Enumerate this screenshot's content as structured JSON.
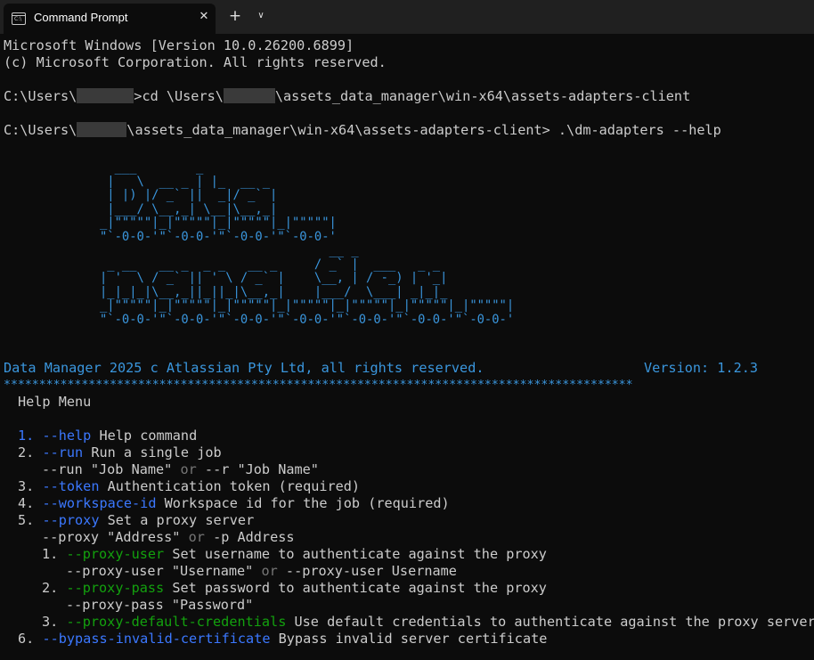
{
  "window": {
    "tab_title": "Command Prompt",
    "tab_icon": "cmd-icon",
    "close_glyph": "✕",
    "new_tab_glyph": "+",
    "dropdown_glyph": "∨"
  },
  "console": {
    "banner": [
      "Microsoft Windows [Version 10.0.26200.6899]",
      "(c) Microsoft Corporation. All rights reserved."
    ],
    "cmd1": {
      "prefix": "C:\\Users\\",
      "mid": ">cd \\Users\\",
      "suffix": "\\assets_data_manager\\win-x64\\assets-adapters-client"
    },
    "cmd2": {
      "prefix": "C:\\Users\\",
      "suffix": "\\assets_data_manager\\win-x64\\assets-adapters-client> .\\dm-adapters --help"
    },
    "ascii_art": [
      "  ___        _         ",
      " |   \\  __ _ | |_  __ _ ",
      " | |) |/ _` ||  _|/ _` |",
      " |___/ \\__,_| \\__|\\__,_|",
      "_|\"\"\"\"\"|_|\"\"\"\"\"|_|\"\"\"\"\"|_|\"\"\"\"\"|",
      "\"`-0-0-'\"`-0-0-'\"`-0-0-'\"`-0-0-'",
      "                               __ _               ",
      " _ __   __ _  _ _   __ _     / _` |  ___   _ _  ",
      "| '  \\ / _` || ' \\ / _` |    \\__, | / -_) | '_| ",
      "|_|_|_|\\__,_||_||_|\\__,_|    |___/  \\___| _|_|_ ",
      "_|\"\"\"\"\"|_|\"\"\"\"\"|_|\"\"\"\"\"|_|\"\"\"\"\"|_|\"\"\"\"\"|_|\"\"\"\"\"|_|\"\"\"\"\"|",
      "\"`-0-0-'\"`-0-0-'\"`-0-0-'\"`-0-0-'\"`-0-0-'\"`-0-0-'\"`-0-0-'"
    ],
    "copyright": "Data Manager 2025 c Atlassian Pty Ltd, all rights reserved.",
    "version": "Version: 1.2.3",
    "separator": "*****************************************************************************************",
    "help_title": "Help Menu",
    "items": {
      "i1": {
        "num": "1.",
        "flag": "--help",
        "desc": "Help command"
      },
      "i2": {
        "num": "2.",
        "flag": "--run",
        "desc": "Run a single job"
      },
      "i2u": {
        "a": "--run \"Job Name\"",
        "or": "or",
        "b": "--r \"Job Name\""
      },
      "i3": {
        "num": "3.",
        "flag": "--token",
        "desc": "Authentication token (required)"
      },
      "i4": {
        "num": "4.",
        "flag": "--workspace-id",
        "desc": "Workspace id for the job (required)"
      },
      "i5": {
        "num": "5.",
        "flag": "--proxy",
        "desc": "Set a proxy server"
      },
      "i5u": {
        "a": "--proxy \"Address\"",
        "or": "or",
        "b": "-p Address"
      },
      "s1": {
        "num": "1.",
        "flag": "--proxy-user",
        "desc": "Set username to authenticate against the proxy"
      },
      "s1u": {
        "a": "--proxy-user \"Username\"",
        "or": "or",
        "b": "--proxy-user Username"
      },
      "s2": {
        "num": "2.",
        "flag": "--proxy-pass",
        "desc": "Set password to authenticate against the proxy"
      },
      "s2u": {
        "a": "--proxy-pass \"Password\""
      },
      "s3": {
        "num": "3.",
        "flag": "--proxy-default-credentials",
        "desc": "Use default credentials to authenticate against the proxy server"
      },
      "i6": {
        "num": "6.",
        "flag": "--bypass-invalid-certificate",
        "desc": "Bypass invalid server certificate"
      }
    }
  }
}
